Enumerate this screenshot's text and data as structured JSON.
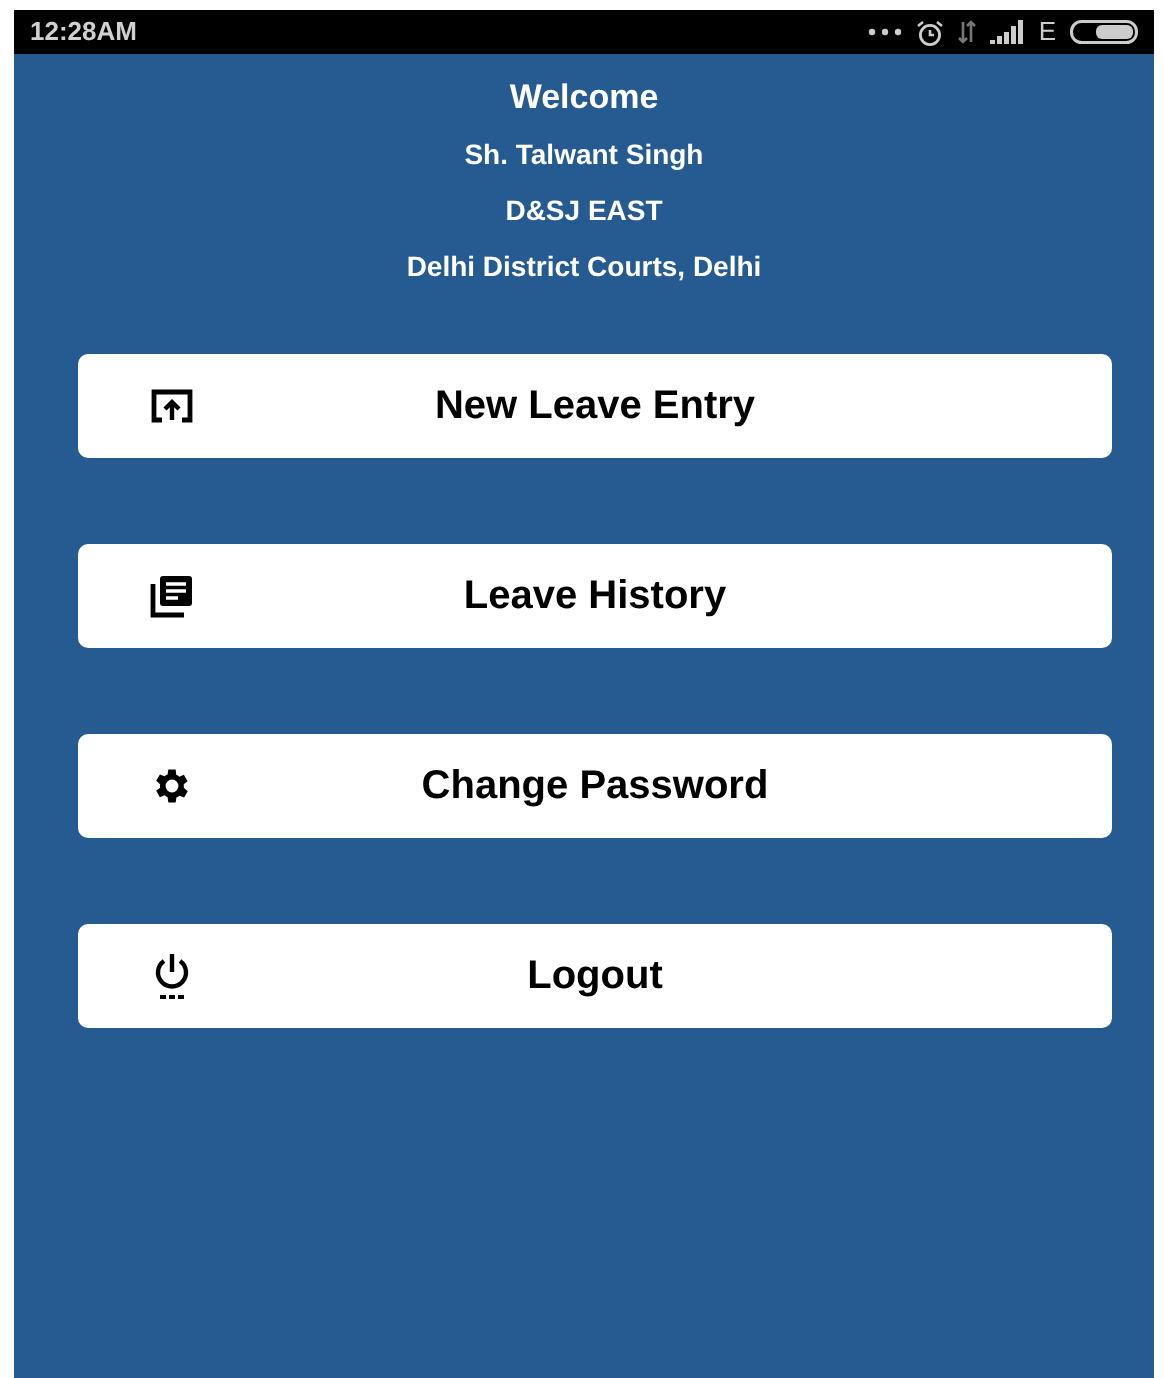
{
  "status_bar": {
    "time": "12:28AM",
    "network_type": "E"
  },
  "header": {
    "title": "Welcome",
    "lines": [
      "Sh. Talwant Singh",
      "D&SJ EAST",
      "Delhi District Courts, Delhi"
    ]
  },
  "menu": [
    {
      "kind": "upload",
      "label": "New Leave Entry"
    },
    {
      "kind": "history",
      "label": "Leave History"
    },
    {
      "kind": "settings",
      "label": "Change Password"
    },
    {
      "kind": "power",
      "label": "Logout"
    }
  ]
}
